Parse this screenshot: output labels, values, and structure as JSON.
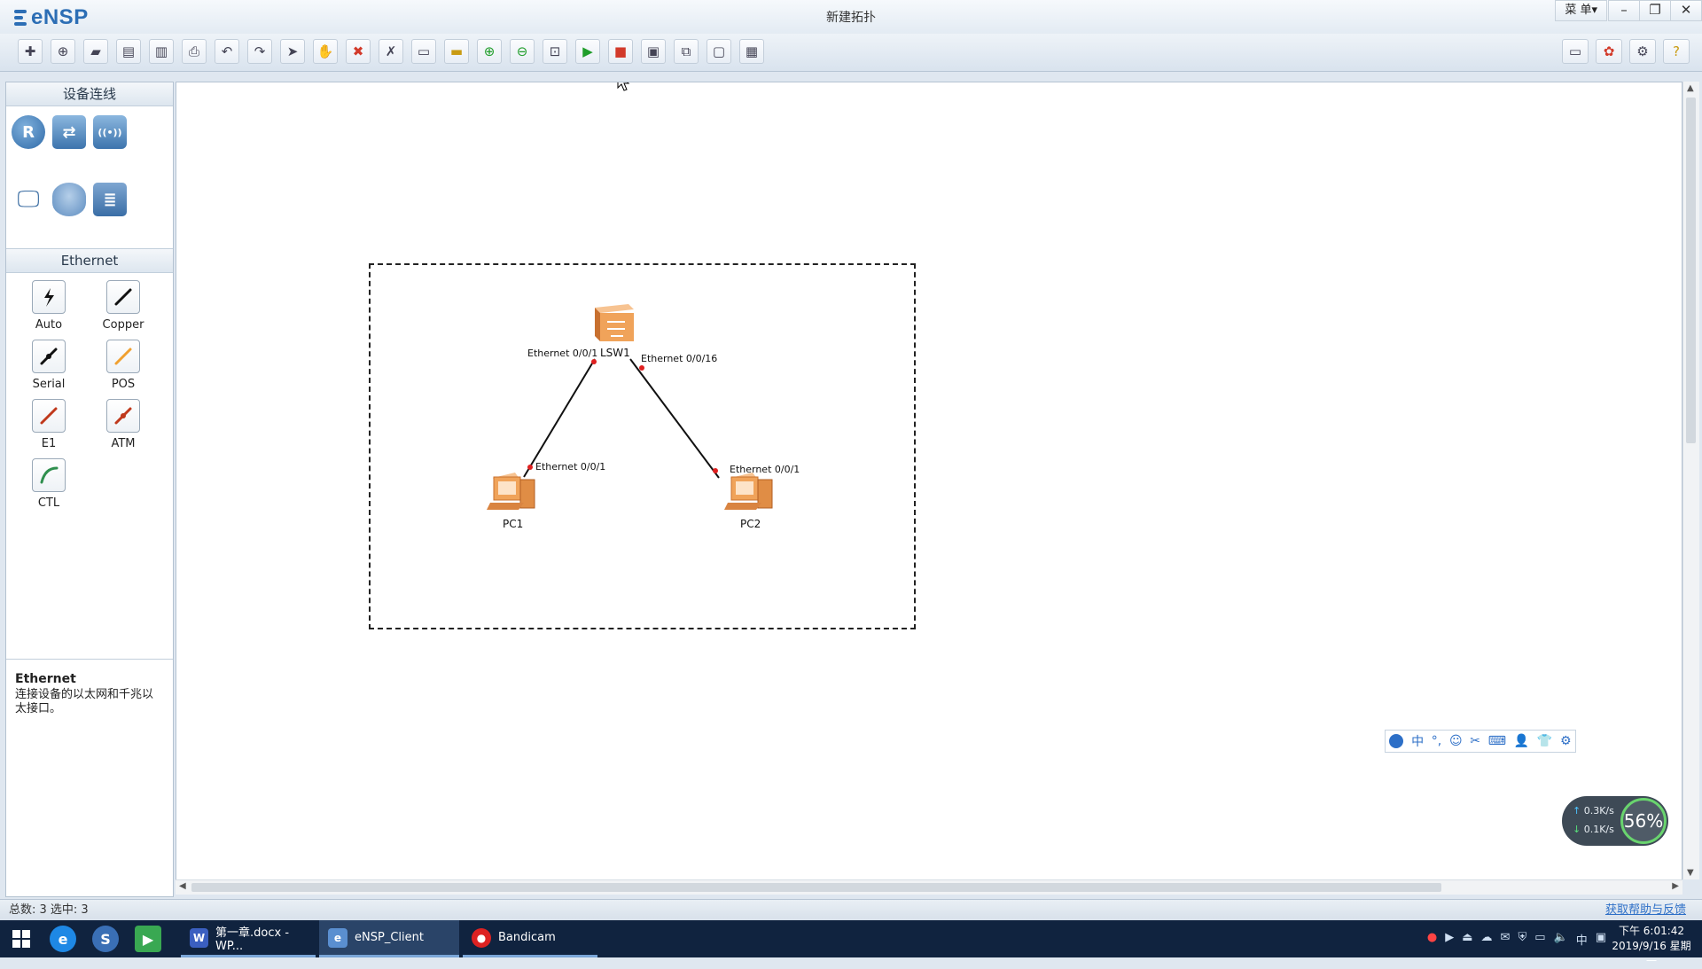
{
  "app": {
    "logo_text": "eNSP",
    "window_title": "新建拓扑",
    "menu_label": "菜 单▾"
  },
  "toolbar": {
    "buttons": [
      {
        "name": "new-topology",
        "icon": "new-file-icon"
      },
      {
        "name": "new-lab",
        "icon": "new-lab-icon"
      },
      {
        "name": "open",
        "icon": "open-folder-icon"
      },
      {
        "name": "save",
        "icon": "save-icon"
      },
      {
        "name": "save-as",
        "icon": "save-as-icon"
      },
      {
        "name": "print",
        "icon": "print-icon"
      },
      {
        "name": "undo",
        "icon": "undo-icon"
      },
      {
        "name": "redo",
        "icon": "redo-icon"
      },
      {
        "name": "select",
        "icon": "pointer-icon"
      },
      {
        "name": "pan",
        "icon": "hand-icon"
      },
      {
        "name": "delete",
        "icon": "delete-icon"
      },
      {
        "name": "delete-links",
        "icon": "delete-link-icon"
      },
      {
        "name": "text",
        "icon": "text-icon"
      },
      {
        "name": "palette",
        "icon": "palette-icon"
      },
      {
        "name": "zoom-in",
        "icon": "zoom-in-icon"
      },
      {
        "name": "zoom-out",
        "icon": "zoom-out-icon"
      },
      {
        "name": "fit",
        "icon": "fit-icon"
      },
      {
        "name": "start",
        "icon": "play-icon"
      },
      {
        "name": "stop",
        "icon": "stop-icon"
      },
      {
        "name": "capture",
        "icon": "capture-icon"
      },
      {
        "name": "topology",
        "icon": "topology-icon"
      },
      {
        "name": "layout",
        "icon": "layout-icon"
      },
      {
        "name": "screenshot",
        "icon": "screenshot-icon"
      }
    ],
    "right_buttons": [
      {
        "name": "chat",
        "icon": "chat-icon"
      },
      {
        "name": "huawei",
        "icon": "huawei-logo-icon"
      },
      {
        "name": "settings",
        "icon": "gear-icon"
      },
      {
        "name": "help",
        "icon": "help-icon"
      }
    ]
  },
  "left_panel": {
    "devices_header": "设备连线",
    "devices": [
      {
        "name": "router",
        "icon": "router-icon",
        "glyph": "R"
      },
      {
        "name": "switch",
        "icon": "switch-icon",
        "glyph": "⇄"
      },
      {
        "name": "wlan",
        "icon": "wlan-icon",
        "glyph": "((•))"
      },
      {
        "name": "firewall",
        "icon": "firewall-icon",
        "glyph": "▦"
      },
      {
        "name": "pc",
        "icon": "pc-icon",
        "glyph": "🖵"
      },
      {
        "name": "cloud",
        "icon": "cloud-icon",
        "glyph": ""
      },
      {
        "name": "server",
        "icon": "server-icon",
        "glyph": "≣"
      },
      {
        "name": "connection",
        "icon": "connection-icon",
        "glyph": "⚡"
      }
    ],
    "cables_header": "Ethernet",
    "cables": [
      {
        "label": "Auto",
        "icon": "auto-cable-icon",
        "color": "#111111"
      },
      {
        "label": "Copper",
        "icon": "copper-cable-icon",
        "color": "#111111"
      },
      {
        "label": "Serial",
        "icon": "serial-cable-icon",
        "color": "#111111"
      },
      {
        "label": "POS",
        "icon": "pos-cable-icon",
        "color": "#f0a030"
      },
      {
        "label": "E1",
        "icon": "e1-cable-icon",
        "color": "#c0391c"
      },
      {
        "label": "ATM",
        "icon": "atm-cable-icon",
        "color": "#c0391c"
      },
      {
        "label": "CTL",
        "icon": "ctl-cable-icon",
        "color": "#2f8f4e"
      }
    ],
    "description": {
      "title": "Ethernet",
      "text": "连接设备的以太网和千兆以太接口。"
    }
  },
  "topology": {
    "nodes": [
      {
        "id": "LSW1",
        "label": "LSW1",
        "type": "switch"
      },
      {
        "id": "PC1",
        "label": "PC1",
        "type": "pc"
      },
      {
        "id": "PC2",
        "label": "PC2",
        "type": "pc"
      }
    ],
    "links": [
      {
        "from": "LSW1",
        "from_port": "Ethernet 0/0/1",
        "to": "PC1",
        "to_port": "Ethernet 0/0/1"
      },
      {
        "from": "LSW1",
        "from_port": "Ethernet 0/0/16",
        "to": "PC2",
        "to_port": "Ethernet 0/0/1"
      }
    ],
    "link_color": "#111111",
    "port_dot_color": "#e02020"
  },
  "ime_toolbar": {
    "items": [
      "中",
      "°,",
      "☺",
      "✂",
      "⌨",
      "👤",
      "👕",
      "⚙"
    ]
  },
  "net_speed": {
    "up": "0.3K/s",
    "down": "0.1K/s",
    "percent": "56%"
  },
  "status_bar": {
    "summary": "总数: 3  选中: 3",
    "help_link": "获取帮助与反馈"
  },
  "taskbar": {
    "tasks": [
      {
        "label": "第一章.docx - WP...",
        "icon": "wps-icon"
      },
      {
        "label": "eNSP_Client",
        "icon": "ensp-icon"
      },
      {
        "label": "Bandicam",
        "icon": "record-icon"
      }
    ],
    "ime_indicator": "中",
    "time": "下午 6:01:42",
    "date": "2019/9/16 星期一"
  },
  "colors": {
    "accent": "#2c6eb5",
    "switch_orange": "#f0a35a",
    "taskbar": "#10233f"
  }
}
